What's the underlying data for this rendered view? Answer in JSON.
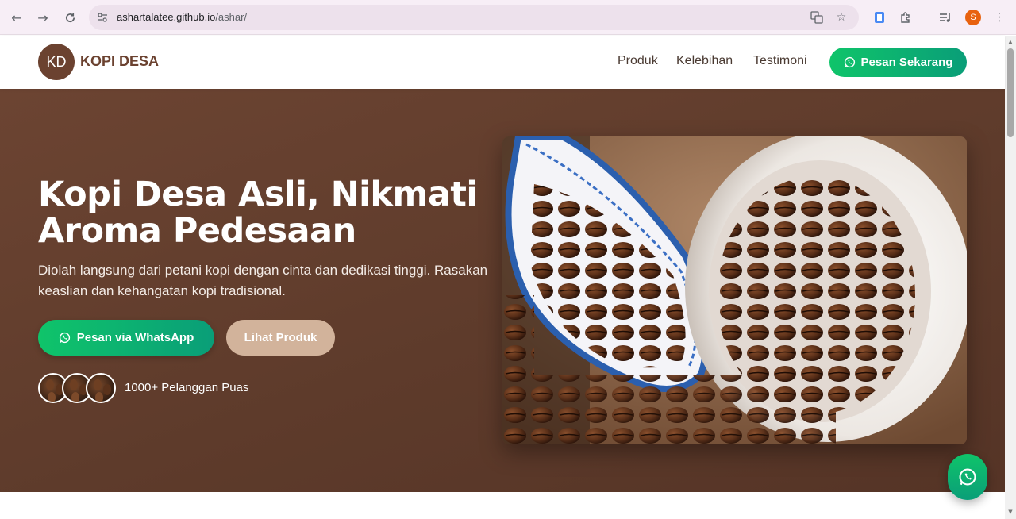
{
  "browser": {
    "url_host": "ashartalatee.github.io",
    "url_path": "/ashar/",
    "profile_initial": "S"
  },
  "site": {
    "logo_initials": "KD",
    "logo_text": "KOPI DESA",
    "nav": [
      "Produk",
      "Kelebihan",
      "Testimoni"
    ],
    "cta_label": "Pesan Sekarang"
  },
  "hero": {
    "title": "Kopi Desa Asli, Nikmati Aroma Pedesaan",
    "subtitle": "Diolah langsung dari petani kopi dengan cinta dan dedikasi tinggi. Rasakan keaslian dan kehangatan kopi tradisional.",
    "btn_whatsapp": "Pesan via WhatsApp",
    "btn_products": "Lihat Produk",
    "customers": "1000+ Pelanggan Puas"
  },
  "colors": {
    "brand_brown": "#6b4230",
    "whatsapp_green": "#0fc46a",
    "button_tan": "#d2b39b"
  }
}
